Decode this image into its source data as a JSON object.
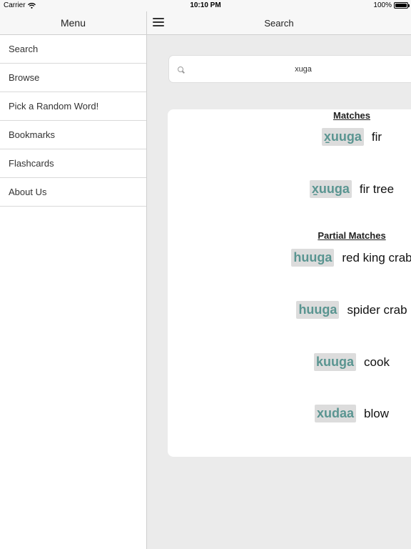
{
  "status_bar": {
    "carrier": "Carrier",
    "time": "10:10 PM",
    "battery": "100%",
    "battery_level": 1.0
  },
  "sidebar": {
    "title": "Menu",
    "items": [
      {
        "label": "Search"
      },
      {
        "label": "Browse"
      },
      {
        "label": "Pick a Random Word!"
      },
      {
        "label": "Bookmarks"
      },
      {
        "label": "Flashcards"
      },
      {
        "label": "About Us"
      }
    ]
  },
  "main": {
    "title": "Search",
    "search": {
      "value": "xuga"
    },
    "matches": {
      "heading": "Matches",
      "entries": [
        {
          "word": "x̱uuga",
          "gloss": "fir"
        },
        {
          "word": "x̱uuga",
          "gloss": "fir tree"
        }
      ]
    },
    "partial": {
      "heading": "Partial Matches",
      "entries": [
        {
          "word": "huuga",
          "gloss": "red king crab"
        },
        {
          "word": "huuga",
          "gloss": "spider crab"
        },
        {
          "word": "kuuga",
          "gloss": "cook"
        },
        {
          "word": "xudaa",
          "gloss": "blow"
        }
      ]
    }
  },
  "colors": {
    "word_text": "#5a9591",
    "word_bg": "#dcdcdc",
    "background": "#ebebeb"
  }
}
